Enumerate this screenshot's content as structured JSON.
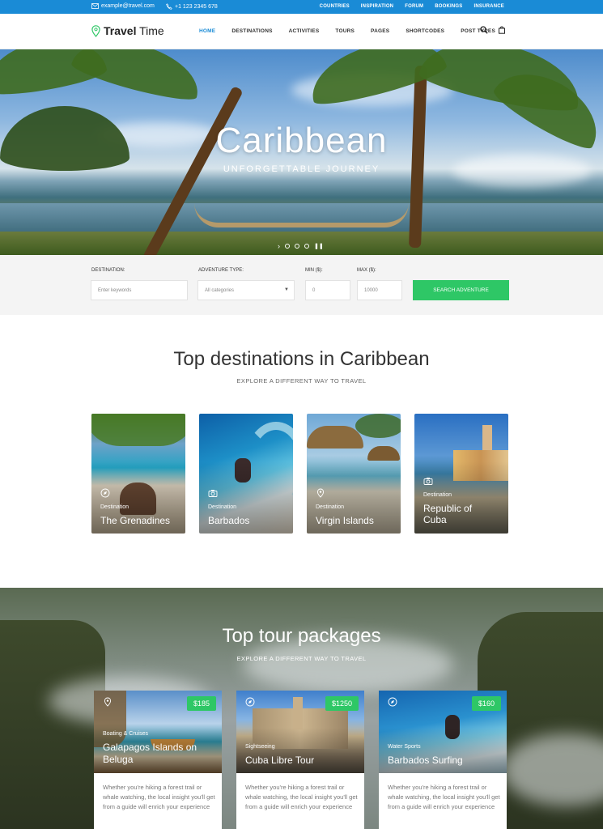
{
  "topbar": {
    "email": "example@travel.com",
    "phone": "+1 123 2345 678",
    "links": [
      "COUNTRIES",
      "INSPIRATION",
      "FORUM",
      "BOOKINGS",
      "INSURANCE"
    ]
  },
  "header": {
    "brand_bold": "Travel",
    "brand_rest": " Time",
    "nav": [
      "HOME",
      "DESTINATIONS",
      "ACTIVITIES",
      "TOURS",
      "PAGES",
      "SHORTCODES",
      "POST TYPES"
    ],
    "search_icon": "search-icon",
    "cart_icon": "bag-icon"
  },
  "hero": {
    "title": "Caribbean",
    "subtitle": "UNFORGETTABLE JOURNEY"
  },
  "search": {
    "destination_label": "DESTINATION:",
    "destination_placeholder": "Enter keywords",
    "type_label": "ADVENTURE TYPE:",
    "type_value": "All categories",
    "min_label": "MIN ($):",
    "min_value": "0",
    "max_label": "MAX ($):",
    "max_value": "10000",
    "button": "SEARCH ADVENTURE"
  },
  "destinations": {
    "title": "Top destinations in Caribbean",
    "subtitle": "EXPLORE A DIFFERENT WAY TO TRAVEL",
    "cards": [
      {
        "category": "Destination",
        "name": "The Grenadines",
        "icon": "compass-icon"
      },
      {
        "category": "Destination",
        "name": "Barbados",
        "icon": "camera-icon"
      },
      {
        "category": "Destination",
        "name": "Virgin Islands",
        "icon": "map-pin-icon"
      },
      {
        "category": "Destination",
        "name": "Republic of Cuba",
        "icon": "camera-icon"
      }
    ]
  },
  "tours": {
    "title": "Top tour packages",
    "subtitle": "EXPLORE A DIFFERENT WAY TO TRAVEL",
    "cards": [
      {
        "price": "$185",
        "category": "Boating & Cruises",
        "name": "Galapagos Islands on Beluga",
        "desc": "Whether you're hiking a forest trail or whale watching, the local insight you'll get from a guide will enrich your experience",
        "icon": "map-pin-icon"
      },
      {
        "price": "$1250",
        "category": "Sightseeing",
        "name": "Cuba Libre Tour",
        "desc": "Whether you're hiking a forest trail or whale watching, the local insight you'll get from a guide will enrich your experience",
        "icon": "compass-icon"
      },
      {
        "price": "$160",
        "category": "Water Sports",
        "name": "Barbados Surfing",
        "desc": "Whether you're hiking a forest trail or whale watching, the local insight you'll get from a guide will enrich your experience",
        "icon": "compass-icon"
      }
    ]
  },
  "colors": {
    "accent": "#1a8bd6",
    "cta": "#2ec766"
  }
}
